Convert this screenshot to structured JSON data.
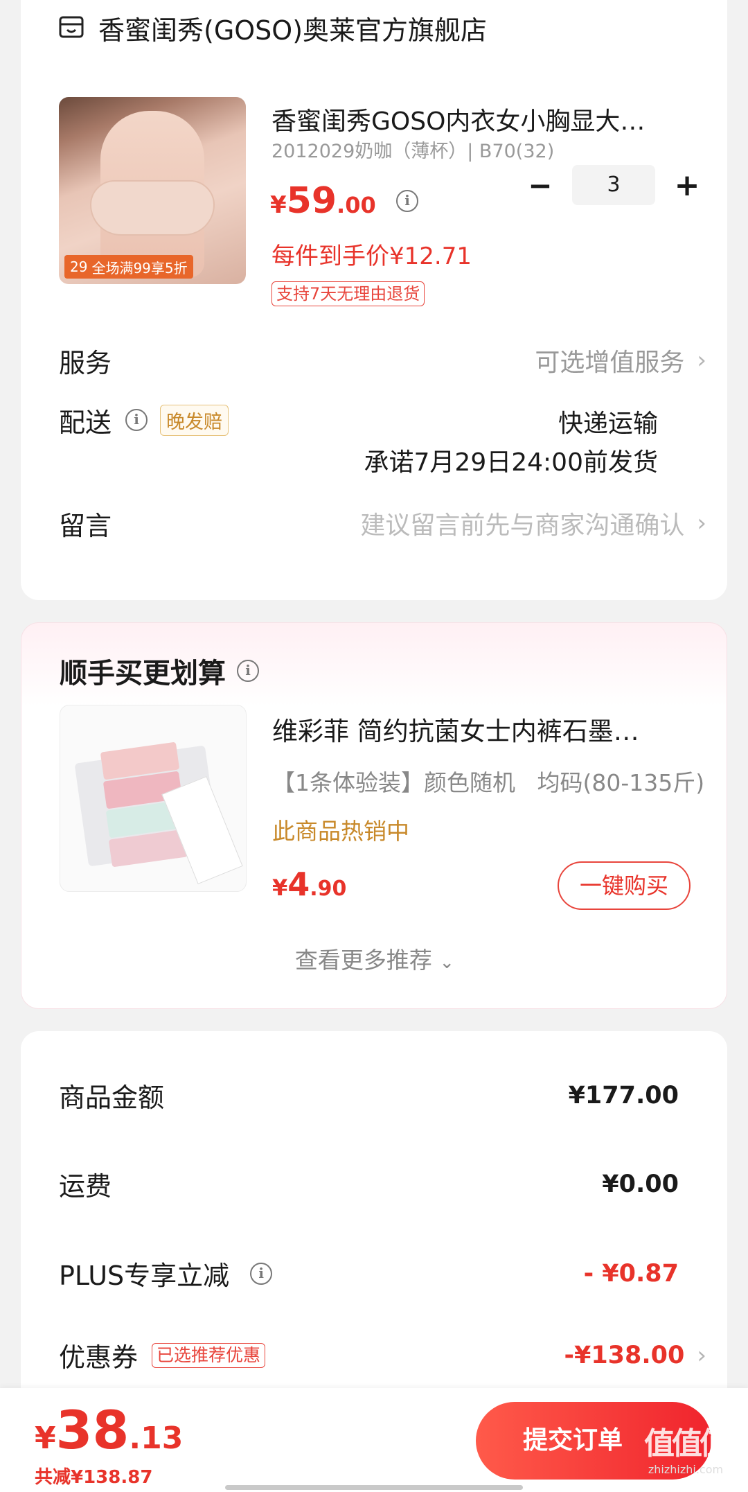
{
  "store": {
    "name": "香蜜闺秀(GOSO)奥莱官方旗舰店",
    "icon": "store-icon"
  },
  "product": {
    "title": "香蜜闺秀GOSO内衣女小胸显大…",
    "spec": "2012029奶咖（薄杯）| B70(32)",
    "price_symbol": "¥",
    "price_int": "59",
    "price_dec": ".00",
    "unit_price": "每件到手价¥12.71",
    "return_tag": "支持7天无理由退货",
    "quantity": "3",
    "image_badge_num": "29",
    "image_badge_text": "全场满99享5折",
    "minus_label": "−",
    "plus_label": "+"
  },
  "service": {
    "label": "服务",
    "value": "可选增值服务"
  },
  "delivery": {
    "label": "配送",
    "badge": "晚发赔",
    "method": "快递运输",
    "promise": "承诺7月29日24:00前发货"
  },
  "message": {
    "label": "留言",
    "placeholder": "建议留言前先与商家沟通确认"
  },
  "recommend": {
    "title": "顺手买更划算",
    "item_title": "维彩菲 简约抗菌女士内裤石墨…",
    "item_spec": "【1条体验装】颜色随机   均码(80-135斤)",
    "hot_text": "此商品热销中",
    "price_symbol": "¥",
    "price_int": "4",
    "price_dec": ".90",
    "buy_button": "一键购买",
    "more": "查看更多推荐"
  },
  "summary": {
    "goods_label": "商品金额",
    "goods_value": "¥177.00",
    "shipping_label": "运费",
    "shipping_value": "¥0.00",
    "plus_label": "PLUS专享立减",
    "plus_value": "- ¥0.87",
    "coupon_label": "优惠券",
    "coupon_tag": "已选推荐优惠",
    "coupon_value": "-¥138.00"
  },
  "footer": {
    "price_symbol": "¥",
    "price_int": "38",
    "price_dec": ".13",
    "saved": "共减¥138.87",
    "submit": "提交订单",
    "watermark": "值值值",
    "watermark_site": "zhizhizhi.com"
  },
  "colors": {
    "accent": "#e8332a",
    "gold": "#c8892a",
    "page_bg": "#f2f2f2"
  }
}
